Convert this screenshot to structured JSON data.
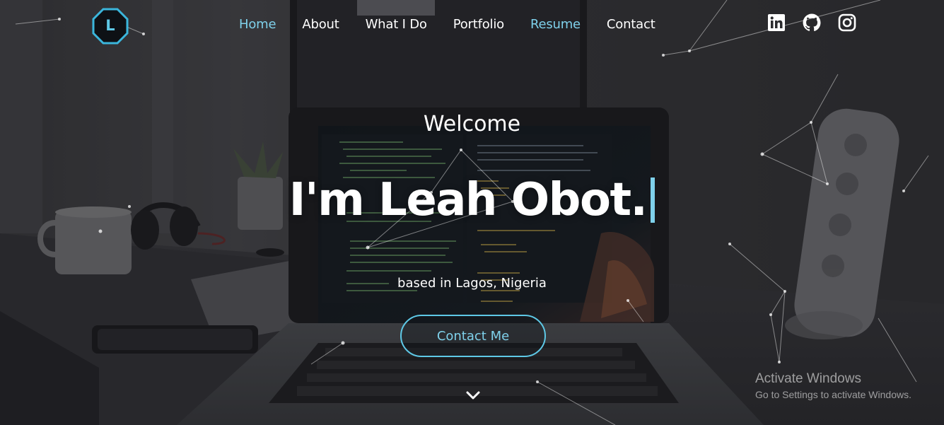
{
  "brand": {
    "logo_letter": "L",
    "accent": "#5ec8e6",
    "active_color": "#7fd1eb"
  },
  "nav": {
    "items": [
      {
        "label": "Home",
        "active": true
      },
      {
        "label": "About",
        "active": false
      },
      {
        "label": "What I Do",
        "active": false
      },
      {
        "label": "Portfolio",
        "active": false
      },
      {
        "label": "Resume",
        "active": true
      },
      {
        "label": "Contact",
        "active": false
      }
    ]
  },
  "social": {
    "icons": [
      "linkedin-icon",
      "github-icon",
      "instagram-icon"
    ]
  },
  "hero": {
    "welcome": "Welcome",
    "headline": "I'm Leah Obot.",
    "subtitle": "based in Lagos, Nigeria",
    "cta_label": "Contact Me"
  },
  "watermark": {
    "title": "Activate Windows",
    "subtitle": "Go to Settings to activate Windows."
  }
}
